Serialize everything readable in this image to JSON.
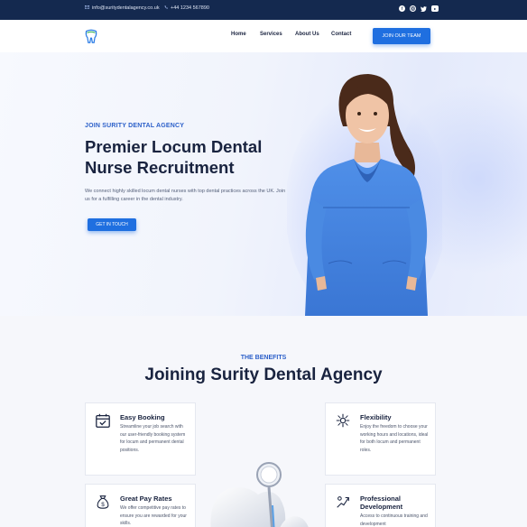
{
  "topbar": {
    "email": "info@suritydentalagency.co.uk",
    "phone": "+44 1234 567890",
    "social_icons": [
      "facebook-icon",
      "instagram-icon",
      "twitter-icon",
      "youtube-icon"
    ]
  },
  "header": {
    "nav": [
      "Home",
      "Services",
      "About Us",
      "Contact"
    ],
    "cta": "JOIN OUR TEAM"
  },
  "hero": {
    "kicker": "JOIN SURITY DENTAL AGENCY",
    "title": "Premier Locum Dental Nurse Recruitment",
    "subtitle": "We connect highly skilled locum dental nurses with top dental practices across the UK. Join us for a fulfilling career in the dental industry.",
    "cta": "GET IN TOUCH"
  },
  "benefits": {
    "kicker": "THE BENEFITS",
    "title": "Joining Surity Dental Agency",
    "cards": [
      {
        "title": "Easy Booking",
        "text": "Streamline your job search with our user-friendly booking system for locum and permanent dental positions.",
        "icon": "calendar-check-icon"
      },
      {
        "title": "Flexibility",
        "text": "Enjoy the freedom to choose your working hours and locations, ideal for both locum and permanent roles.",
        "icon": "flexibility-icon"
      },
      {
        "title": "Great Pay Rates",
        "text": "We offer competitive pay rates to ensure you are rewarded for your skills.",
        "icon": "money-bag-icon"
      },
      {
        "title": "Professional Development",
        "text": "Access to continuous training and development",
        "icon": "development-icon"
      }
    ]
  },
  "colors": {
    "navy": "#14294f",
    "accent": "#1f6fe0",
    "kicker": "#2b5fc9"
  }
}
